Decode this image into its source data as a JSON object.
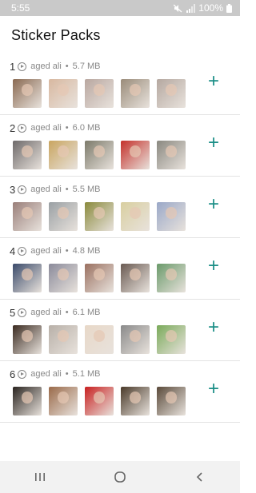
{
  "status_bar": {
    "time": "5:55",
    "battery": "100%",
    "icons": [
      "mute-icon",
      "signal-icon",
      "battery-icon"
    ]
  },
  "app": {
    "title": "Sticker Packs"
  },
  "colors": {
    "accent": "#1a8e86",
    "status_bar_bg": "#c9c9c9"
  },
  "packs": [
    {
      "number": "1",
      "author": "aged ali",
      "separator": "•",
      "size": "5.7 MB",
      "stickers": [
        "#8a6a52",
        "#d8b8a0",
        "#b9a7a0",
        "#9a8c7a",
        "#b5a8a0"
      ]
    },
    {
      "number": "2",
      "author": "aged ali",
      "separator": "•",
      "size": "6.0 MB",
      "stickers": [
        "#6e6a6a",
        "#c9a560",
        "#7c7a6a",
        "#c4302a",
        "#8a8880"
      ]
    },
    {
      "number": "3",
      "author": "aged ali",
      "separator": "•",
      "size": "5.5 MB",
      "stickers": [
        "#9a7f7a",
        "#9aa0a4",
        "#8a8a3c",
        "#d9cfa0",
        "#9aa8c8"
      ]
    },
    {
      "number": "4",
      "author": "aged ali",
      "separator": "•",
      "size": "4.8 MB",
      "stickers": [
        "#3a4a6a",
        "#8a8a9a",
        "#9a7060",
        "#6a5a52",
        "#6a9a6a"
      ]
    },
    {
      "number": "5",
      "author": "aged ali",
      "separator": "•",
      "size": "6.1 MB",
      "stickers": [
        "#3a2a20",
        "#b8b0a8",
        "#e8d8c8",
        "#8a8a8a",
        "#7aaa5a"
      ]
    },
    {
      "number": "6",
      "author": "aged ali",
      "separator": "•",
      "size": "5.1 MB",
      "stickers": [
        "#2a2420",
        "#9a6a4a",
        "#c82020",
        "#4a3a2a",
        "#5a4a3a"
      ]
    }
  ],
  "add_label": "+",
  "nav": {
    "buttons": [
      "recent-apps-icon",
      "home-icon",
      "back-icon"
    ]
  }
}
